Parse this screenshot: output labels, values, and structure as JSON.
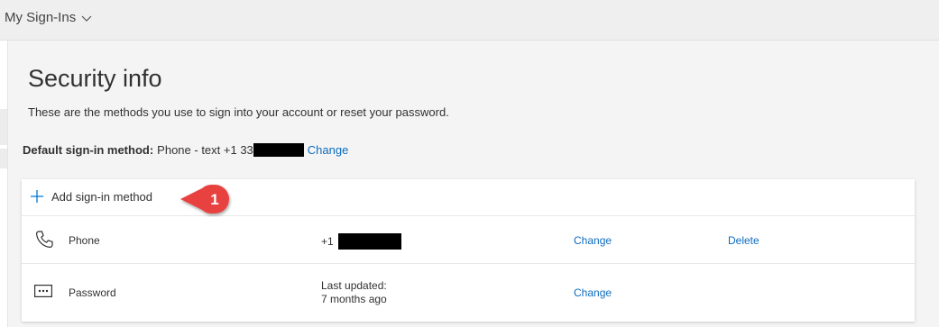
{
  "header": {
    "app_title": "My Sign-Ins"
  },
  "main": {
    "title": "Security info",
    "description": "These are the methods you use to sign into your account or reset your password.",
    "default_method": {
      "label": "Default sign-in method:",
      "value": "Phone - text +1 33",
      "change_label": "Change"
    }
  },
  "methods_card": {
    "add_label": "Add sign-in method",
    "rows": [
      {
        "name": "Phone",
        "detail_prefix": "+1",
        "action1": "Change",
        "action2": "Delete"
      },
      {
        "name": "Password",
        "detail_line1": "Last updated:",
        "detail_line2": "7 months ago",
        "action1": "Change"
      }
    ]
  },
  "annotation": {
    "number": "1",
    "color": "#e8423f"
  },
  "colors": {
    "link": "#0e6cbe",
    "accent": "#0078d4"
  }
}
